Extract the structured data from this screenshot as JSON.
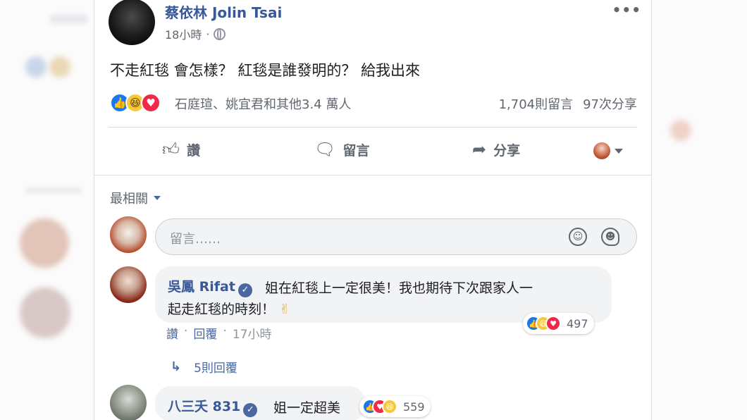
{
  "post": {
    "author": "蔡依林 Jolin Tsai",
    "time": "18小時",
    "separator": "·",
    "text": "不走紅毯 會怎樣？ 紅毯是誰發明的？ 給我出來",
    "reactors": "石庭瑄、姚宜君和其他3.4 萬人",
    "comments_count": "1,704則留言",
    "shares_count": "97次分享",
    "more": "•••"
  },
  "actions": {
    "like": "讚",
    "comment": "留言",
    "share": "分享"
  },
  "sort": {
    "label": "最相關"
  },
  "composer": {
    "placeholder": "留言……"
  },
  "comments": [
    {
      "name": "吳鳳 Rifat",
      "text_line1": "姐在紅毯上一定很美！我也期待下次跟家人一",
      "text_line2": "起走紅毯的時刻！",
      "reaction_count": "497",
      "like": "讚",
      "reply": "回覆",
      "time": "17小時",
      "replies": "5則回覆"
    },
    {
      "name": "八三夭 831",
      "text": "姐一定超美",
      "reaction_count": "559"
    }
  ],
  "colors": {
    "link": "#385898",
    "like": "#1877f2",
    "love": "#f0284a",
    "haha": "#f7c93a",
    "bubble": "#f2f3f5"
  },
  "icons": [
    "globe-icon",
    "more-icon",
    "like-icon",
    "comment-icon",
    "share-icon",
    "emoji-icon",
    "sticker-icon",
    "verified-icon",
    "reply-arrow-icon",
    "victory-hand-icon"
  ]
}
